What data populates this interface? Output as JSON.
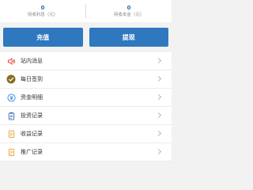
{
  "stats": [
    {
      "value": "0",
      "label": "待收利息（元）"
    },
    {
      "value": "0",
      "label": "待收本金（元）"
    }
  ],
  "actions": {
    "recharge_label": "充值",
    "withdraw_label": "提现"
  },
  "menu": [
    {
      "label": "站内消息",
      "icon": "speaker-icon"
    },
    {
      "label": "每日签到",
      "icon": "check-in-icon"
    },
    {
      "label": "资金明细",
      "icon": "yen-icon"
    },
    {
      "label": "投资记录",
      "icon": "clipboard-icon"
    },
    {
      "label": "收益记录",
      "icon": "document-icon"
    },
    {
      "label": "推广记录",
      "icon": "document-icon"
    }
  ],
  "colors": {
    "accent": "#2f78bf",
    "value_text": "#2f6eb3",
    "message_icon": "#e2473b",
    "checkin_icon": "#8a6d1f",
    "record_icon": "#e7a63a"
  }
}
